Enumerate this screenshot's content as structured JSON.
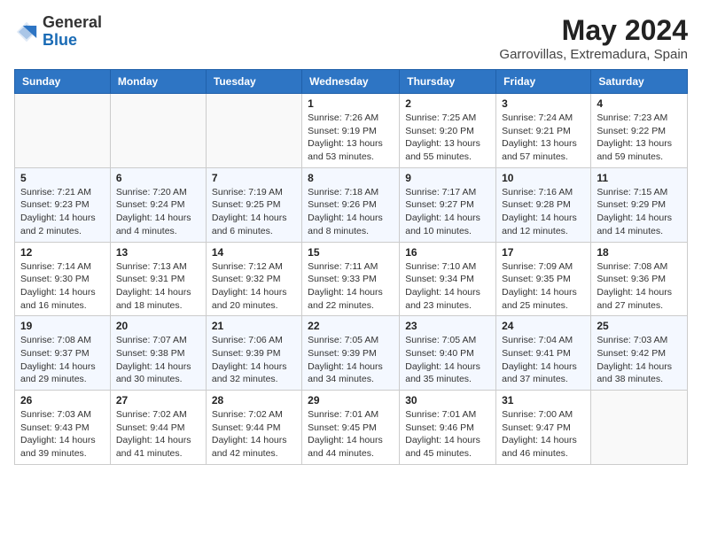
{
  "logo": {
    "general": "General",
    "blue": "Blue"
  },
  "title": "May 2024",
  "subtitle": "Garrovillas, Extremadura, Spain",
  "days_of_week": [
    "Sunday",
    "Monday",
    "Tuesday",
    "Wednesday",
    "Thursday",
    "Friday",
    "Saturday"
  ],
  "weeks": [
    [
      {
        "day": "",
        "info": ""
      },
      {
        "day": "",
        "info": ""
      },
      {
        "day": "",
        "info": ""
      },
      {
        "day": "1",
        "info": "Sunrise: 7:26 AM\nSunset: 9:19 PM\nDaylight: 13 hours and 53 minutes."
      },
      {
        "day": "2",
        "info": "Sunrise: 7:25 AM\nSunset: 9:20 PM\nDaylight: 13 hours and 55 minutes."
      },
      {
        "day": "3",
        "info": "Sunrise: 7:24 AM\nSunset: 9:21 PM\nDaylight: 13 hours and 57 minutes."
      },
      {
        "day": "4",
        "info": "Sunrise: 7:23 AM\nSunset: 9:22 PM\nDaylight: 13 hours and 59 minutes."
      }
    ],
    [
      {
        "day": "5",
        "info": "Sunrise: 7:21 AM\nSunset: 9:23 PM\nDaylight: 14 hours and 2 minutes."
      },
      {
        "day": "6",
        "info": "Sunrise: 7:20 AM\nSunset: 9:24 PM\nDaylight: 14 hours and 4 minutes."
      },
      {
        "day": "7",
        "info": "Sunrise: 7:19 AM\nSunset: 9:25 PM\nDaylight: 14 hours and 6 minutes."
      },
      {
        "day": "8",
        "info": "Sunrise: 7:18 AM\nSunset: 9:26 PM\nDaylight: 14 hours and 8 minutes."
      },
      {
        "day": "9",
        "info": "Sunrise: 7:17 AM\nSunset: 9:27 PM\nDaylight: 14 hours and 10 minutes."
      },
      {
        "day": "10",
        "info": "Sunrise: 7:16 AM\nSunset: 9:28 PM\nDaylight: 14 hours and 12 minutes."
      },
      {
        "day": "11",
        "info": "Sunrise: 7:15 AM\nSunset: 9:29 PM\nDaylight: 14 hours and 14 minutes."
      }
    ],
    [
      {
        "day": "12",
        "info": "Sunrise: 7:14 AM\nSunset: 9:30 PM\nDaylight: 14 hours and 16 minutes."
      },
      {
        "day": "13",
        "info": "Sunrise: 7:13 AM\nSunset: 9:31 PM\nDaylight: 14 hours and 18 minutes."
      },
      {
        "day": "14",
        "info": "Sunrise: 7:12 AM\nSunset: 9:32 PM\nDaylight: 14 hours and 20 minutes."
      },
      {
        "day": "15",
        "info": "Sunrise: 7:11 AM\nSunset: 9:33 PM\nDaylight: 14 hours and 22 minutes."
      },
      {
        "day": "16",
        "info": "Sunrise: 7:10 AM\nSunset: 9:34 PM\nDaylight: 14 hours and 23 minutes."
      },
      {
        "day": "17",
        "info": "Sunrise: 7:09 AM\nSunset: 9:35 PM\nDaylight: 14 hours and 25 minutes."
      },
      {
        "day": "18",
        "info": "Sunrise: 7:08 AM\nSunset: 9:36 PM\nDaylight: 14 hours and 27 minutes."
      }
    ],
    [
      {
        "day": "19",
        "info": "Sunrise: 7:08 AM\nSunset: 9:37 PM\nDaylight: 14 hours and 29 minutes."
      },
      {
        "day": "20",
        "info": "Sunrise: 7:07 AM\nSunset: 9:38 PM\nDaylight: 14 hours and 30 minutes."
      },
      {
        "day": "21",
        "info": "Sunrise: 7:06 AM\nSunset: 9:39 PM\nDaylight: 14 hours and 32 minutes."
      },
      {
        "day": "22",
        "info": "Sunrise: 7:05 AM\nSunset: 9:39 PM\nDaylight: 14 hours and 34 minutes."
      },
      {
        "day": "23",
        "info": "Sunrise: 7:05 AM\nSunset: 9:40 PM\nDaylight: 14 hours and 35 minutes."
      },
      {
        "day": "24",
        "info": "Sunrise: 7:04 AM\nSunset: 9:41 PM\nDaylight: 14 hours and 37 minutes."
      },
      {
        "day": "25",
        "info": "Sunrise: 7:03 AM\nSunset: 9:42 PM\nDaylight: 14 hours and 38 minutes."
      }
    ],
    [
      {
        "day": "26",
        "info": "Sunrise: 7:03 AM\nSunset: 9:43 PM\nDaylight: 14 hours and 39 minutes."
      },
      {
        "day": "27",
        "info": "Sunrise: 7:02 AM\nSunset: 9:44 PM\nDaylight: 14 hours and 41 minutes."
      },
      {
        "day": "28",
        "info": "Sunrise: 7:02 AM\nSunset: 9:44 PM\nDaylight: 14 hours and 42 minutes."
      },
      {
        "day": "29",
        "info": "Sunrise: 7:01 AM\nSunset: 9:45 PM\nDaylight: 14 hours and 44 minutes."
      },
      {
        "day": "30",
        "info": "Sunrise: 7:01 AM\nSunset: 9:46 PM\nDaylight: 14 hours and 45 minutes."
      },
      {
        "day": "31",
        "info": "Sunrise: 7:00 AM\nSunset: 9:47 PM\nDaylight: 14 hours and 46 minutes."
      },
      {
        "day": "",
        "info": ""
      }
    ]
  ]
}
